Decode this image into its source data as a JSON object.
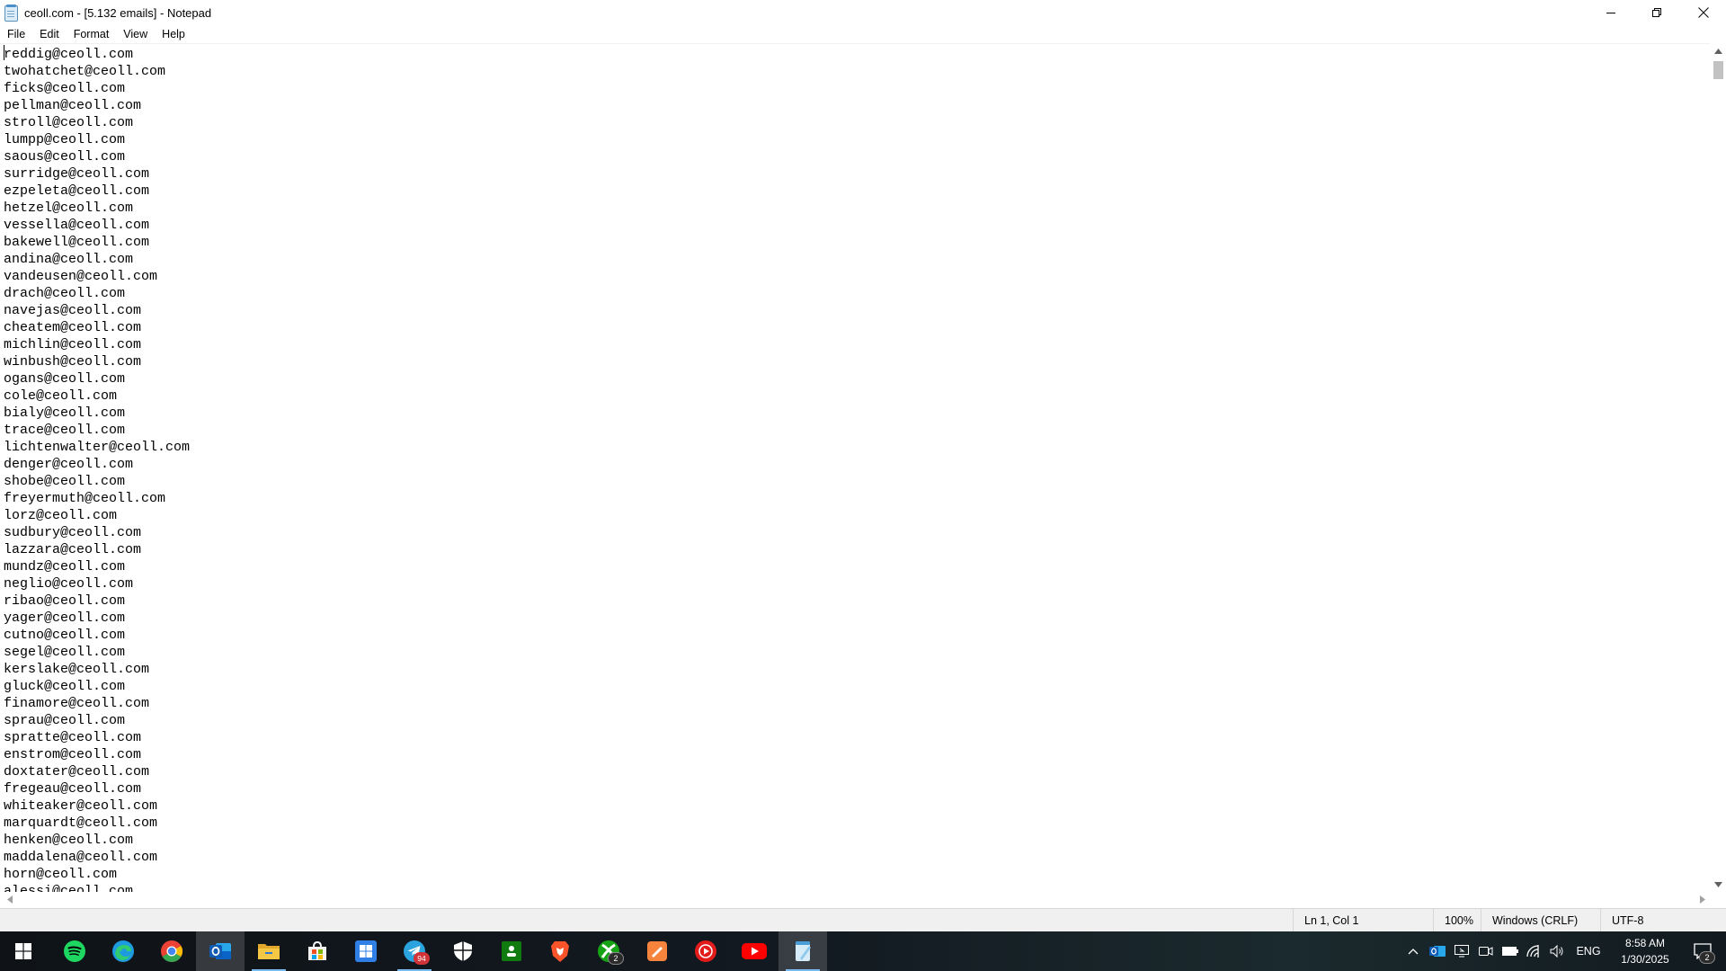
{
  "window": {
    "title": "ceoll.com - [5.132 emails] - Notepad",
    "icon": "notepad-icon"
  },
  "menu": [
    "File",
    "Edit",
    "Format",
    "View",
    "Help"
  ],
  "editor": {
    "lines": [
      "reddig@ceoll.com",
      "twohatchet@ceoll.com",
      "ficks@ceoll.com",
      "pellman@ceoll.com",
      "stroll@ceoll.com",
      "lumpp@ceoll.com",
      "saous@ceoll.com",
      "surridge@ceoll.com",
      "ezpeleta@ceoll.com",
      "hetzel@ceoll.com",
      "vessella@ceoll.com",
      "bakewell@ceoll.com",
      "andina@ceoll.com",
      "vandeusen@ceoll.com",
      "drach@ceoll.com",
      "navejas@ceoll.com",
      "cheatem@ceoll.com",
      "michlin@ceoll.com",
      "winbush@ceoll.com",
      "ogans@ceoll.com",
      "cole@ceoll.com",
      "bialy@ceoll.com",
      "trace@ceoll.com",
      "lichtenwalter@ceoll.com",
      "denger@ceoll.com",
      "shobe@ceoll.com",
      "freyermuth@ceoll.com",
      "lorz@ceoll.com",
      "sudbury@ceoll.com",
      "lazzara@ceoll.com",
      "mundz@ceoll.com",
      "neglio@ceoll.com",
      "ribao@ceoll.com",
      "yager@ceoll.com",
      "cutno@ceoll.com",
      "segel@ceoll.com",
      "kerslake@ceoll.com",
      "gluck@ceoll.com",
      "finamore@ceoll.com",
      "sprau@ceoll.com",
      "spratte@ceoll.com",
      "enstrom@ceoll.com",
      "doxtater@ceoll.com",
      "fregeau@ceoll.com",
      "whiteaker@ceoll.com",
      "marquardt@ceoll.com",
      "henken@ceoll.com",
      "maddalena@ceoll.com",
      "horn@ceoll.com",
      "alessi@ceoll.com"
    ]
  },
  "status": {
    "position": "Ln 1, Col 1",
    "zoom": "100%",
    "line_ending": "Windows (CRLF)",
    "encoding": "UTF-8"
  },
  "taskbar": {
    "apps": [
      {
        "name": "spotify-icon",
        "color": "#1ed760"
      },
      {
        "name": "edge-icon",
        "color": "#1e9be0"
      },
      {
        "name": "chrome-icon",
        "color": "#ea4335"
      },
      {
        "name": "outlook-icon",
        "color": "#0a64c8"
      },
      {
        "name": "file-explorer-icon",
        "color": "#f3c43d"
      },
      {
        "name": "microsoft-store-icon",
        "color": "#ffffff"
      },
      {
        "name": "windows-app-icon",
        "color": "#3a8ef0"
      },
      {
        "name": "telegram-icon",
        "color": "#2aa3de",
        "badge": "94"
      },
      {
        "name": "security-shield-icon",
        "color": "#ffffff"
      },
      {
        "name": "xbox-app-icon",
        "color": "#107c10"
      },
      {
        "name": "brave-icon",
        "color": "#fb542b"
      },
      {
        "name": "xbox-icon",
        "color": "#16a316",
        "badge": "2"
      },
      {
        "name": "paint-app-icon",
        "color": "#f7843c"
      },
      {
        "name": "youtube-music-icon",
        "color": "#e21b1b"
      },
      {
        "name": "youtube-icon",
        "color": "#ff0000"
      },
      {
        "name": "notepad-icon",
        "color": "#8ec9ec"
      }
    ],
    "tray": {
      "language": "ENG",
      "time": "8:58 AM",
      "date": "1/30/2025",
      "notifications": "2"
    }
  }
}
